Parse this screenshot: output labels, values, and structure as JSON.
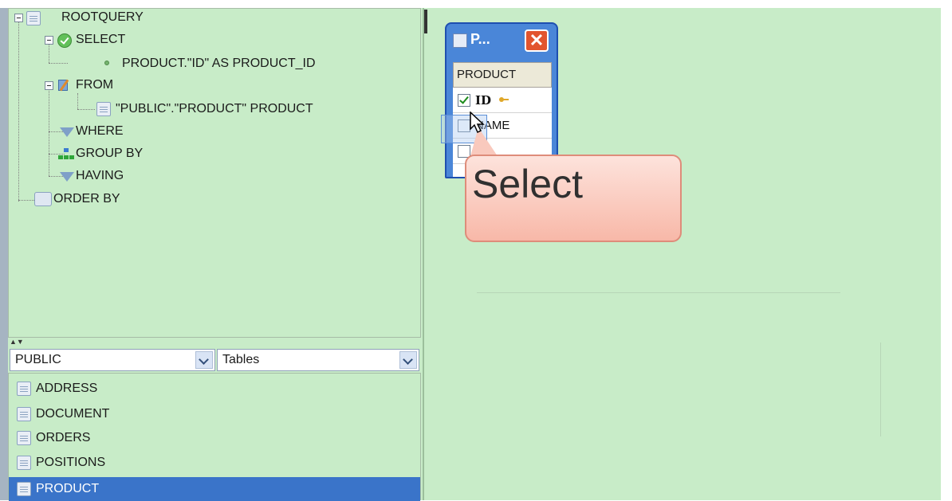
{
  "tree": {
    "root": "ROOTQUERY",
    "select": "SELECT",
    "select_item": "PRODUCT.\"ID\" AS PRODUCT_ID",
    "from": "FROM",
    "from_item": "\"PUBLIC\".\"PRODUCT\" PRODUCT",
    "where": "WHERE",
    "group_by": "GROUP BY",
    "having": "HAVING",
    "order_by": "ORDER BY"
  },
  "splitter": "▲▼",
  "schema_combo": {
    "value": "PUBLIC"
  },
  "type_combo": {
    "value": "Tables"
  },
  "table_list": [
    "ADDRESS",
    "DOCUMENT",
    "ORDERS",
    "POSITIONS",
    "PRODUCT"
  ],
  "table_window": {
    "title": "P...",
    "close": "✕",
    "header": "PRODUCT",
    "columns": [
      {
        "name": "ID",
        "checked": true
      },
      {
        "name": "NAME",
        "checked": false
      }
    ]
  },
  "callout": {
    "text": "Select"
  },
  "colors": {
    "panel_bg": "#c8ecc8",
    "selection": "#3a74c9",
    "window_frame": "#1e4fb0",
    "close_button": "#e2542e",
    "callout_fill": "#f8b8a8"
  },
  "icons": [
    "folder-doc-icon",
    "check-circle-icon",
    "dot-icon",
    "from-icon",
    "funnel-icon",
    "group-icon",
    "order-icon",
    "table-icon",
    "key-icon",
    "chevron-down-icon",
    "close-icon",
    "cursor-icon"
  ]
}
